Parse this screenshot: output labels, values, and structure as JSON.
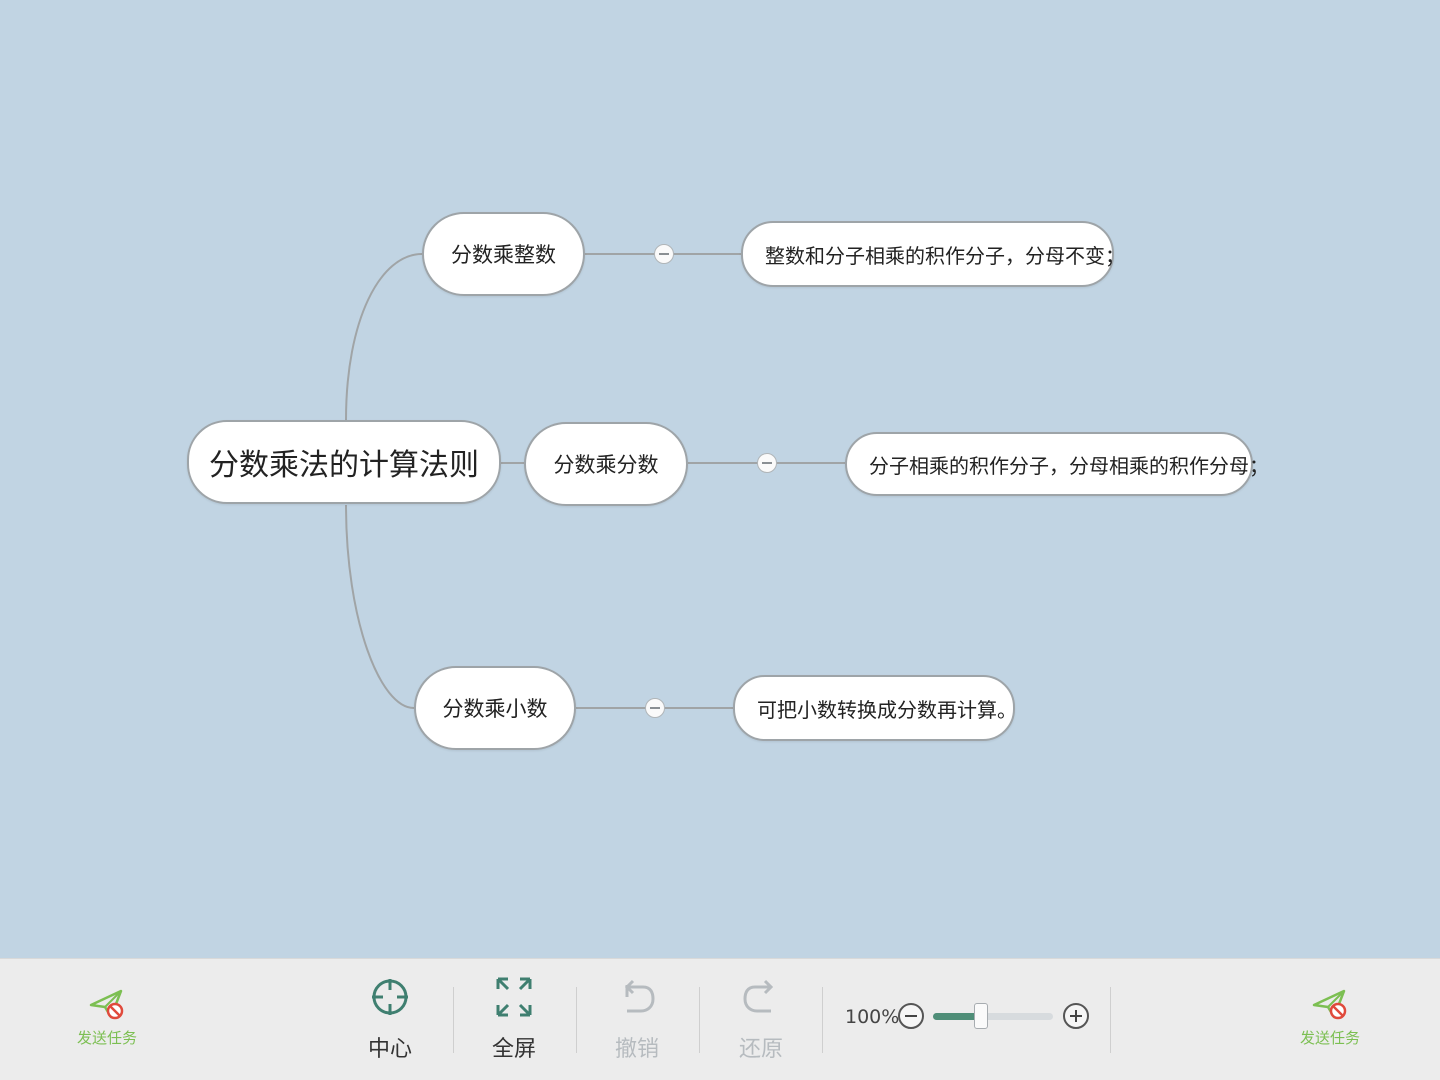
{
  "mindmap": {
    "root": "分数乘法的计算法则",
    "branches": [
      {
        "title": "分数乘整数",
        "detail": "整数和分子相乘的积作分子，分母不变；"
      },
      {
        "title": "分数乘分数",
        "detail": "分子相乘的积作分子，分母相乘的积作分母；"
      },
      {
        "title": "分数乘小数",
        "detail": "可把小数转换成分数再计算。"
      }
    ]
  },
  "toolbar": {
    "send_left": "发送任务",
    "send_right": "发送任务",
    "center": "中心",
    "fullscreen": "全屏",
    "undo": "撤销",
    "redo": "还原",
    "zoom_label": "100%",
    "zoom_level": 0.4
  },
  "colors": {
    "canvas_bg": "#c1d4e3",
    "node_border": "#9ea4a8",
    "connector": "#a0a4a6",
    "slider_fill": "#4f8e78",
    "send_green": "#7cbf52",
    "disabled": "#b6bbbf",
    "center_icon": "#3f7f70"
  }
}
